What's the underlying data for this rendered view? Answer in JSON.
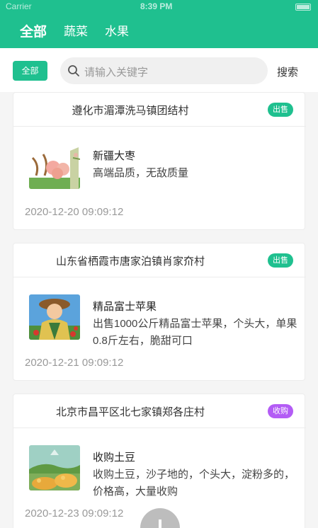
{
  "status": {
    "carrier": "Carrier",
    "time": "8:39 PM"
  },
  "tabs": [
    "全部",
    "蔬菜",
    "水果"
  ],
  "filter": {
    "label": "全部"
  },
  "search": {
    "placeholder": "请输入关键字",
    "action": "搜索"
  },
  "colors": {
    "accent": "#1fc08f",
    "sell_badge": "#1fc08f",
    "buy_badge": "#b35cf5"
  },
  "items": [
    {
      "location": "遵化市湄潭洗马镇团结村",
      "badge": "出售",
      "badge_type": "sell",
      "title": "新疆大枣",
      "description": "高端品质，无敌质量",
      "time": "2020-12-20 09:09:12",
      "image": "farm-illustration"
    },
    {
      "location": "山东省栖霞市唐家泊镇肖家夼村",
      "badge": "出售",
      "badge_type": "sell",
      "title": "精品富士苹果",
      "description": "出售1000公斤精品富士苹果，个头大，单果0.8斤左右，脆甜可口",
      "time": "2020-12-21 09:09:12",
      "image": "farmer-illustration"
    },
    {
      "location": "北京市昌平区北七家镇郑各庄村",
      "badge": "收购",
      "badge_type": "buy",
      "title": "收购土豆",
      "description": "收购土豆，沙子地的，个头大，淀粉多的，价格高，大量收购",
      "time": "2020-12-23 09:09:12",
      "image": "harvest-illustration"
    }
  ]
}
